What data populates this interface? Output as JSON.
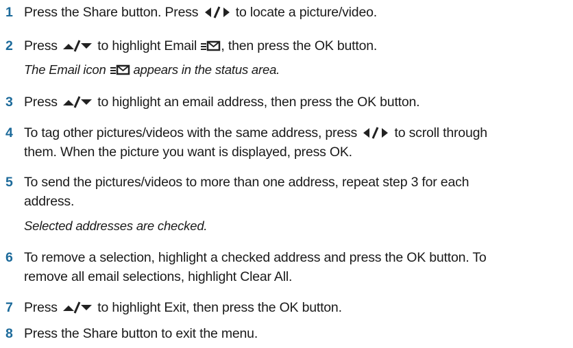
{
  "steps": [
    {
      "number": "1",
      "segments": [
        "Press the Share button. Press ",
        " to locate a picture/video."
      ]
    },
    {
      "number": "2",
      "segments": [
        "Press ",
        " to highlight Email ",
        ", then press the OK button."
      ],
      "note": [
        "The Email icon ",
        " appears in the status area."
      ]
    },
    {
      "number": "3",
      "segments": [
        "Press ",
        " to highlight an email address, then press the OK button."
      ]
    },
    {
      "number": "4",
      "segments": [
        "To tag other pictures/videos with the same address, press ",
        " to scroll through"
      ],
      "line2": "them. When the picture you want is displayed, press OK."
    },
    {
      "number": "5",
      "line1": "To send the pictures/videos to more than one address, repeat step 3 for each",
      "line2": "address.",
      "note": "Selected addresses are checked."
    },
    {
      "number": "6",
      "line1": "To remove a selection, highlight a checked address and press the OK button. To",
      "line2": "remove all email selections, highlight Clear All."
    },
    {
      "number": "7",
      "segments": [
        "Press ",
        " to highlight Exit, then press the OK button."
      ]
    },
    {
      "number": "8",
      "line1": "Press the Share button to exit the menu."
    }
  ],
  "icons": {
    "left_right": "left-right-arrow-buttons-icon",
    "up_down": "up-down-arrow-buttons-icon",
    "email": "email-icon"
  }
}
